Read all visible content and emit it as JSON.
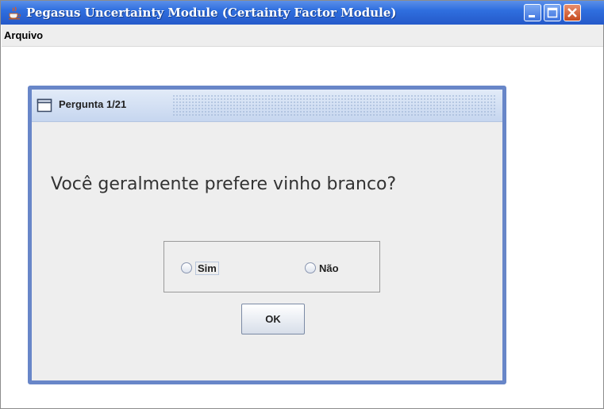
{
  "window": {
    "title": "Pegasus Uncertainty Module (Certainty Factor Module)",
    "app_icon": "java-cup-icon",
    "controls": [
      "minimize-icon",
      "maximize-icon",
      "close-icon"
    ]
  },
  "menubar": {
    "items": [
      {
        "label": "Arquivo"
      }
    ]
  },
  "dialog": {
    "title": "Pergunta 1/21",
    "question": "Você geralmente prefere vinho branco?",
    "options": [
      {
        "label": "Sim",
        "selected": false
      },
      {
        "label": "Não",
        "selected": false
      }
    ],
    "ok_label": "OK"
  },
  "colors": {
    "titlebar": "#2f6fdf",
    "dialog_border": "#6886c8",
    "dialog_bg": "#eeeeee"
  }
}
